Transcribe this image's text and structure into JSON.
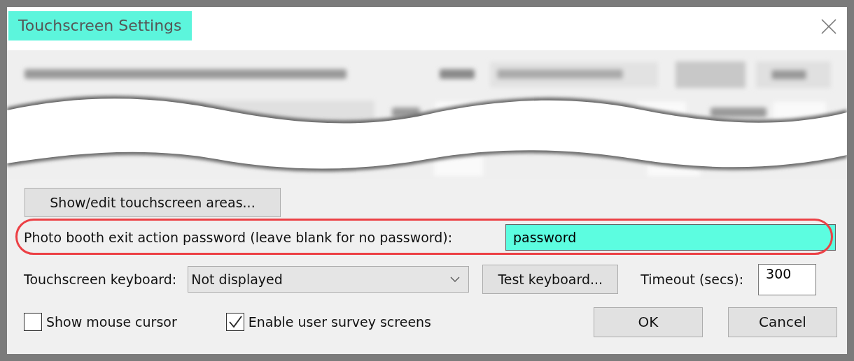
{
  "window": {
    "title": "Touchscreen Settings",
    "title_highlighted": true
  },
  "show_areas_button": "Show/edit touchscreen areas...",
  "password": {
    "label": "Photo booth exit action password (leave blank for no password):",
    "value": "password",
    "highlighted": true,
    "circled": true
  },
  "keyboard": {
    "label": "Touchscreen keyboard:",
    "value": "Not displayed",
    "test_button": "Test keyboard..."
  },
  "timeout": {
    "label": "Timeout (secs):",
    "value": "300"
  },
  "checkboxes": [
    {
      "label": "Show mouse cursor",
      "checked": false
    },
    {
      "label": "Enable user survey screens",
      "checked": true
    }
  ],
  "buttons": [
    {
      "label": "OK"
    },
    {
      "label": "Cancel"
    }
  ]
}
